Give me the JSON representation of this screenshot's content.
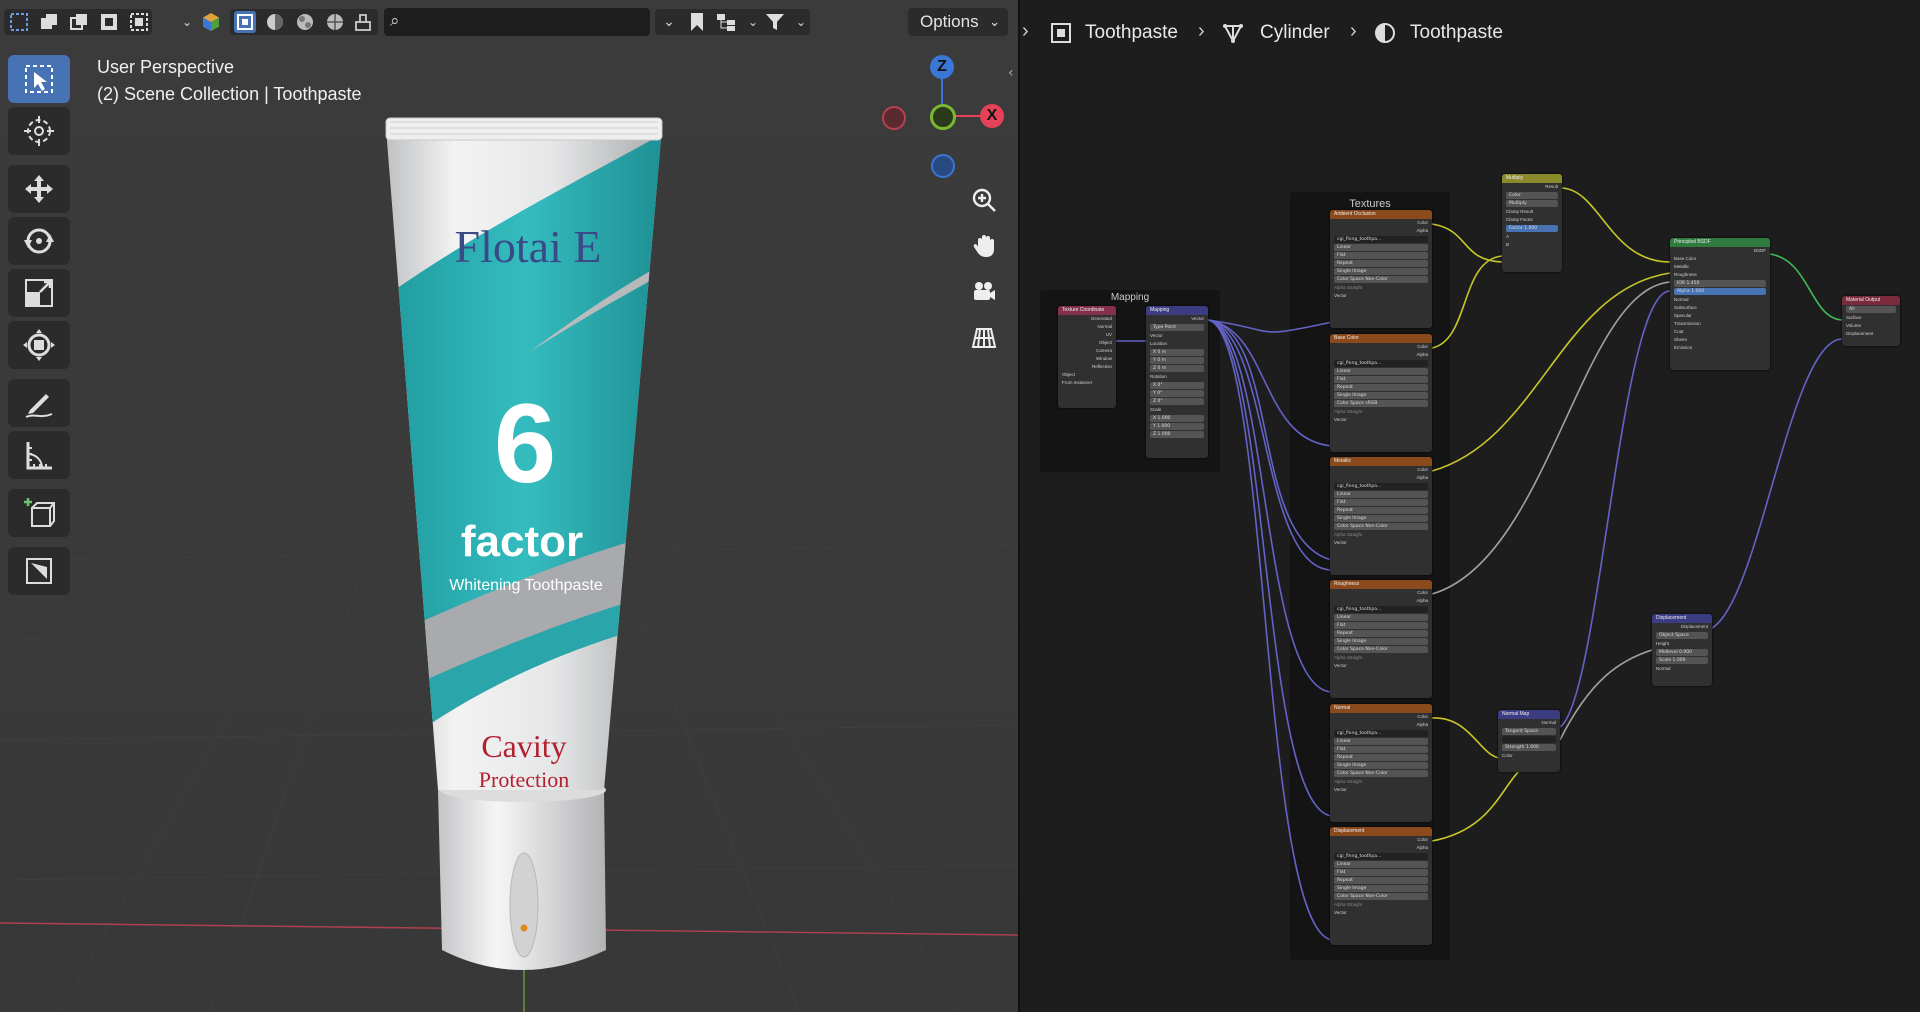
{
  "viewport": {
    "header": {
      "search_placeholder": "",
      "options_label": "Options"
    },
    "overlay": {
      "view_name": "User Perspective",
      "collection_path": "(2) Scene Collection | Toothpaste"
    },
    "toolbar": [
      {
        "name": "select-box-tool",
        "icon": "select-box-icon",
        "active": true
      },
      {
        "name": "cursor-tool",
        "icon": "cursor-icon"
      },
      {
        "name": "move-tool",
        "icon": "move-icon"
      },
      {
        "name": "rotate-tool",
        "icon": "rotate-icon"
      },
      {
        "name": "scale-tool",
        "icon": "scale-icon"
      },
      {
        "name": "transform-tool",
        "icon": "transform-icon"
      },
      {
        "name": "annotate-tool",
        "icon": "annotate-icon"
      },
      {
        "name": "measure-tool",
        "icon": "measure-icon"
      },
      {
        "name": "add-cube-tool",
        "icon": "add-cube-icon"
      },
      {
        "name": "extra-tool",
        "icon": "box-icon"
      }
    ],
    "gizmo": {
      "z_label": "Z",
      "x_label": "X",
      "colors": {
        "x": "#e54257",
        "y": "#79b92f",
        "z": "#3a77d6"
      }
    },
    "product": {
      "brand": "Flotai E",
      "number": "6",
      "factor": "factor",
      "tagline": "Whitening Toothpaste",
      "cavity": "Cavity",
      "protection": "Protection"
    }
  },
  "node_editor": {
    "breadcrumb": [
      "Toothpaste",
      "Cylinder",
      "Toothpaste"
    ],
    "frames": {
      "mapping": "Mapping",
      "textures": "Textures"
    },
    "nodes": {
      "tex_coord": {
        "title": "Texture Coordinate",
        "outputs": [
          "Generated",
          "Normal",
          "UV",
          "Object",
          "Camera",
          "Window",
          "Reflection"
        ],
        "object_label": "Object",
        "from_instancer": "From Instancer"
      },
      "mapping": {
        "title": "Mapping",
        "output": "Vector",
        "type_label": "Type",
        "type_value": "Point",
        "input": "Vector",
        "location": "Location",
        "rotation": "Rotation",
        "scale": "Scale",
        "x": "X",
        "y": "Y",
        "z": "Z",
        "loc_vals": [
          "0 m",
          "0 m",
          "0 m"
        ],
        "rot_vals": [
          "0°",
          "0°",
          "0°"
        ],
        "scale_vals": [
          "1.000",
          "1.000",
          "1.000"
        ]
      },
      "image_textures": [
        {
          "title": "Ambient Occlusion",
          "image": "cgi_finng_toothpa...",
          "colorspace": "Non-Color"
        },
        {
          "title": "Base Color",
          "image": "cgi_finng_toothpa...",
          "colorspace": "sRGB"
        },
        {
          "title": "Metallic",
          "image": "cgi_finng_toothpa...",
          "colorspace": "Non-Color"
        },
        {
          "title": "Roughness",
          "image": "cgi_finng_toothpa...",
          "colorspace": "Non-Color"
        },
        {
          "title": "Normal",
          "image": "cgi_finng_toothpa...",
          "colorspace": "Non-Color"
        },
        {
          "title": "Displacement",
          "image": "cgi_finng_toothpa...",
          "colorspace": "Non-Color"
        }
      ],
      "image_common": {
        "color": "Color",
        "alpha": "Alpha",
        "linear": "Linear",
        "flat": "Flat",
        "repeat": "Repeat",
        "single_image": "Single Image",
        "colorspace_label": "Color Space",
        "alpha_label": "Alpha",
        "alpha_value": "Straight",
        "vector": "Vector"
      },
      "multiply": {
        "title": "Multiply",
        "output": "Result",
        "color": "Color",
        "mode": "Multiply",
        "clamp_result": "Clamp Result",
        "clamp_factor": "Clamp Factor",
        "factor": "Factor",
        "factor_value": "1.000",
        "a": "A",
        "b": "B"
      },
      "bsdf": {
        "title": "Principled BSDF",
        "output": "BSDF",
        "rows": [
          "Base Color",
          "Metallic",
          "Roughness",
          "IOR",
          "Alpha",
          "Normal",
          "Subsurface",
          "Specular",
          "Transmission",
          "Coat",
          "Sheen",
          "Emission"
        ],
        "ior_value": "1.450",
        "alpha_value": "1.000"
      },
      "material_output": {
        "title": "Material Output",
        "target": "All",
        "inputs": [
          "Surface",
          "Volume",
          "Displacement"
        ]
      },
      "displacement": {
        "title": "Displacement",
        "output": "Displacement",
        "space": "Object Space",
        "height": "Height",
        "midlevel": "Midlevel",
        "midlevel_value": "0.000",
        "scale": "Scale",
        "scale_value": "1.000",
        "normal": "Normal"
      },
      "normal_map": {
        "title": "Normal Map",
        "output": "Normal",
        "space": "Tangent Space",
        "strength": "Strength",
        "strength_value": "1.000",
        "color": "Color"
      }
    }
  }
}
